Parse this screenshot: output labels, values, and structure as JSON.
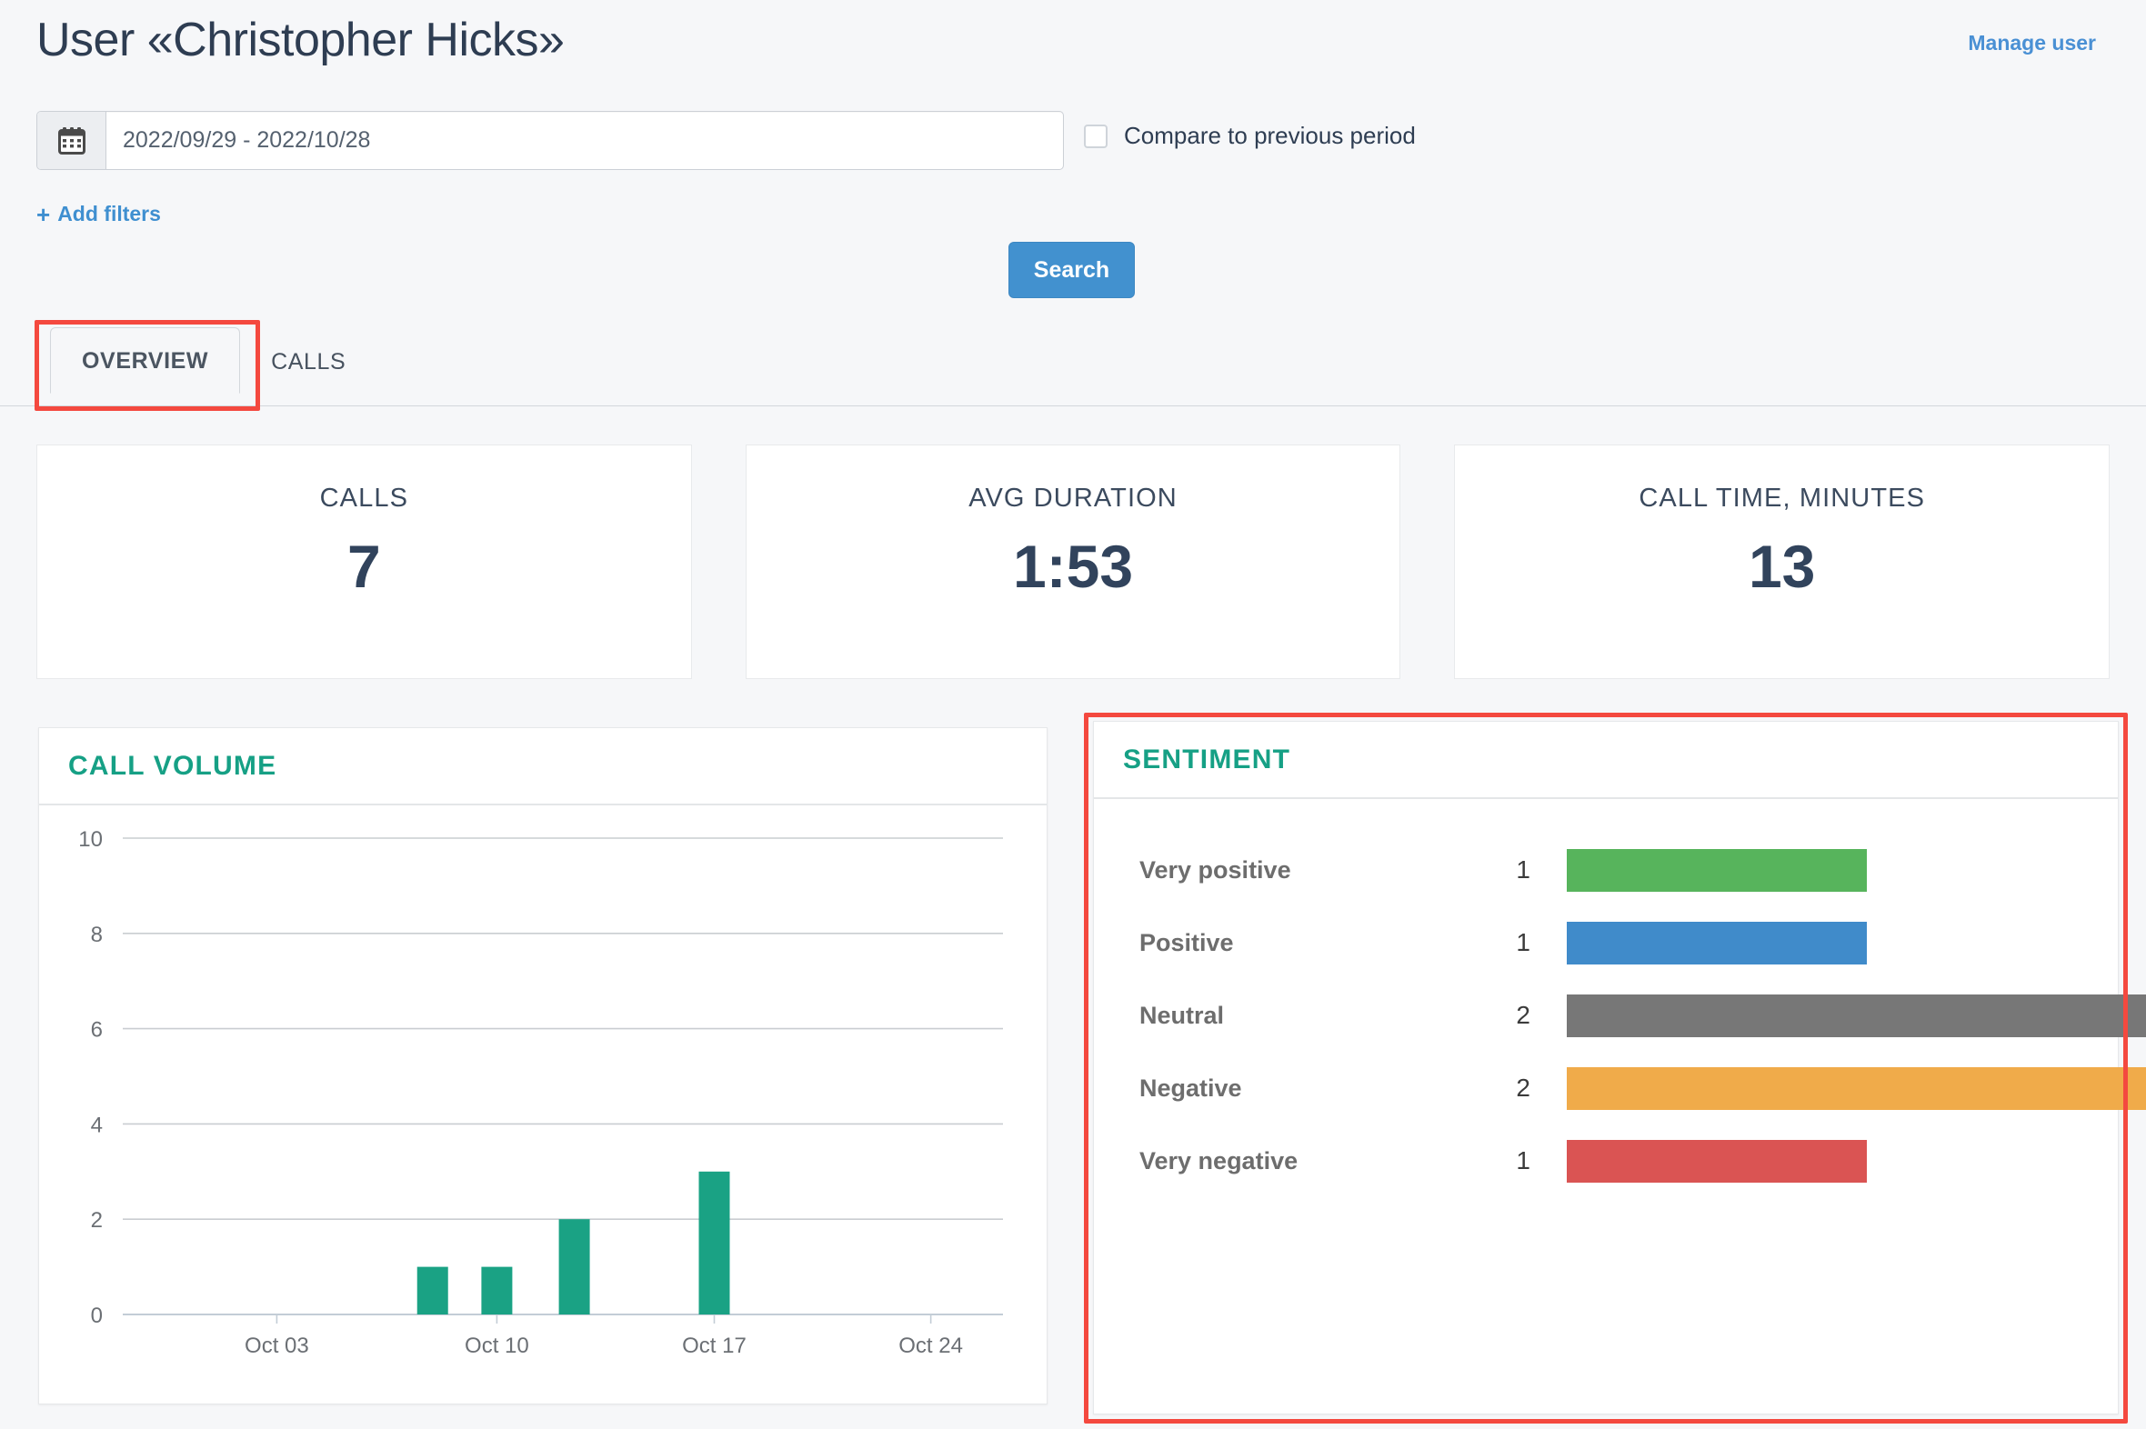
{
  "header": {
    "title": "User «Christopher Hicks»",
    "manage_user_label": "Manage user"
  },
  "filters": {
    "date_range_value": "2022/09/29 - 2022/10/28",
    "date_range_placeholder": "2022/09/29 - 2022/10/28",
    "calendar_icon": "calendar-icon",
    "compare_label": "Compare to previous period",
    "compare_checked": false,
    "add_filters_label": "Add filters",
    "add_filters_plus": "+",
    "search_label": "Search"
  },
  "tabs": [
    {
      "label": "OVERVIEW",
      "active": true
    },
    {
      "label": "CALLS",
      "active": false
    }
  ],
  "stats": [
    {
      "label": "CALLS",
      "value": "7"
    },
    {
      "label": "AVG DURATION",
      "value": "1:53"
    },
    {
      "label": "CALL TIME, MINUTES",
      "value": "13"
    }
  ],
  "call_volume": {
    "title": "CALL  VOLUME"
  },
  "sentiment": {
    "title": "SENTIMENT",
    "rows": [
      {
        "label": "Very positive",
        "count": "1",
        "color": "#57B45C"
      },
      {
        "label": "Positive",
        "count": "1",
        "color": "#408BCA"
      },
      {
        "label": "Neutral",
        "count": "2",
        "color": "#777777"
      },
      {
        "label": "Negative",
        "count": "2",
        "color": "#F0AB4A"
      },
      {
        "label": "Very negative",
        "count": "1",
        "color": "#DA5453"
      }
    ]
  },
  "colors": {
    "accent_teal": "#16a085",
    "accent_blue": "#4291cf",
    "link_blue": "#4a90d4",
    "highlight_red": "#f4493f",
    "bar_teal": "#1aa284",
    "text_dark": "#31435c",
    "page_bg": "#f6f7f9"
  },
  "chart_data": {
    "type": "bar",
    "title": "CALL  VOLUME",
    "xlabel": "",
    "ylabel": "",
    "ylim": [
      0,
      10
    ],
    "yticks": [
      "0",
      "2",
      "4",
      "6",
      "8",
      "10"
    ],
    "grid": true,
    "legend": "none",
    "xticks": [
      "Oct 03",
      "Oct 10",
      "Oct 17",
      "Oct 24"
    ],
    "xtick_positions": [
      0.175,
      0.425,
      0.672,
      0.918
    ],
    "bar_color": "#1aa284",
    "categories": [
      "Oct 08",
      "Oct 10",
      "Oct 12",
      "Oct 17"
    ],
    "values": [
      1,
      1,
      2,
      3
    ],
    "bar_positions": [
      0.352,
      0.425,
      0.513,
      0.672
    ]
  }
}
